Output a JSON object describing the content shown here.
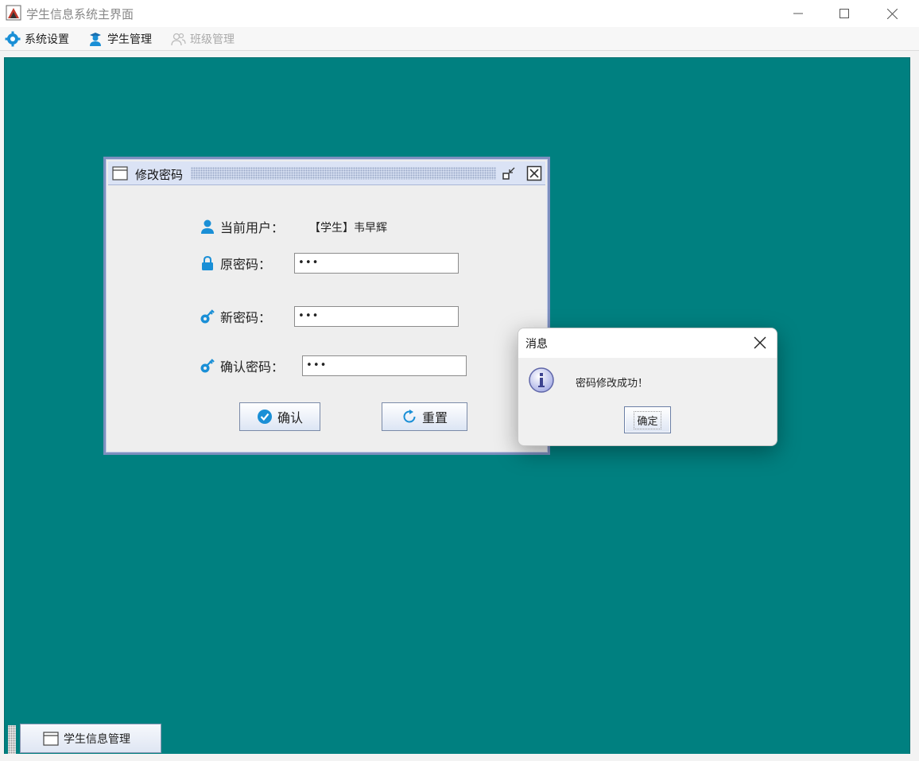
{
  "window": {
    "title": "学生信息系统主界面",
    "controls": [
      "minimize",
      "maximize",
      "close"
    ]
  },
  "menu": {
    "items": [
      {
        "label": "系统设置",
        "icon": "gear-icon",
        "enabled": true
      },
      {
        "label": "学生管理",
        "icon": "student-icon",
        "enabled": true
      },
      {
        "label": "班级管理",
        "icon": "users-icon",
        "enabled": false
      }
    ]
  },
  "change_password_frame": {
    "title": "修改密码",
    "current_user_label": "当前用户：",
    "current_user_value": "【学生】韦早辉",
    "old_password_label": "原密码：",
    "old_password_value": "•••",
    "new_password_label": "新密码：",
    "new_password_value": "•••",
    "confirm_password_label": "确认密码：",
    "confirm_password_value": "•••",
    "confirm_button": "确认",
    "reset_button": "重置"
  },
  "message_dialog": {
    "title": "消息",
    "message": "密码修改成功！",
    "ok_button": "确定"
  },
  "taskbar": {
    "items": [
      {
        "label": "学生信息管理",
        "icon": "window-icon"
      }
    ]
  },
  "colors": {
    "desktop": "#008080",
    "accent_blue": "#1a8fd6",
    "frame_border": "#7d8fbf"
  }
}
